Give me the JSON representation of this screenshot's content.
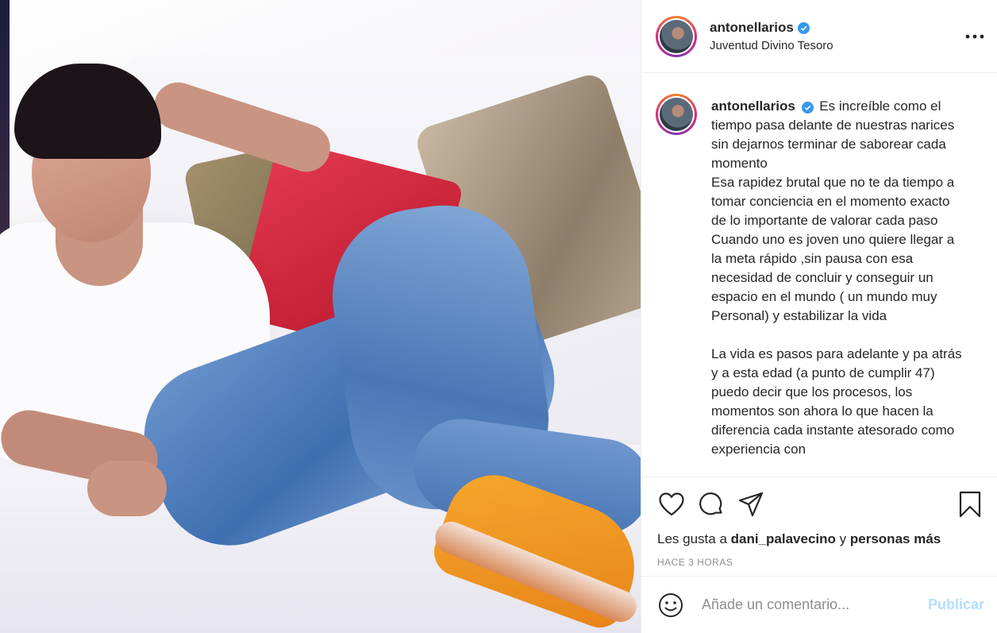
{
  "post": {
    "username": "antonellarios",
    "location": "Juventud Divino Tesoro",
    "caption": "Es increíble como el tiempo pasa delante de nuestras narices sin dejarnos terminar de saborear cada momento\nEsa rapidez brutal que no te da tiempo a tomar conciencia en el momento exacto de lo importante de valorar cada paso\nCuando uno es joven uno quiere llegar a la meta rápido ,sin pausa con esa necesidad de concluir y conseguir un espacio en el mundo ( un mundo muy Personal) y estabilizar la vida\n\nLa vida es pasos para adelante y pa atrás y a esta edad (a punto de cumplir 47) puedo decir que los procesos, los momentos son ahora lo que hacen la diferencia cada instante atesorado como experiencia con",
    "likes_prefix": "Les gusta a",
    "likes_user": "dani_palavecino",
    "likes_connector": "y",
    "likes_suffix": "personas más",
    "timestamp": "HACE 3 HORAS"
  },
  "comment": {
    "placeholder": "Añade un comentario...",
    "publish_label": "Publicar"
  },
  "icons": [
    "more-options-icon",
    "verified-badge-icon",
    "heart-icon",
    "comment-icon",
    "share-icon",
    "bookmark-icon",
    "emoji-icon"
  ],
  "colors": {
    "verified": "#3897f0",
    "publish_disabled": "#b2dffc",
    "timestamp": "#8e8e8e"
  }
}
